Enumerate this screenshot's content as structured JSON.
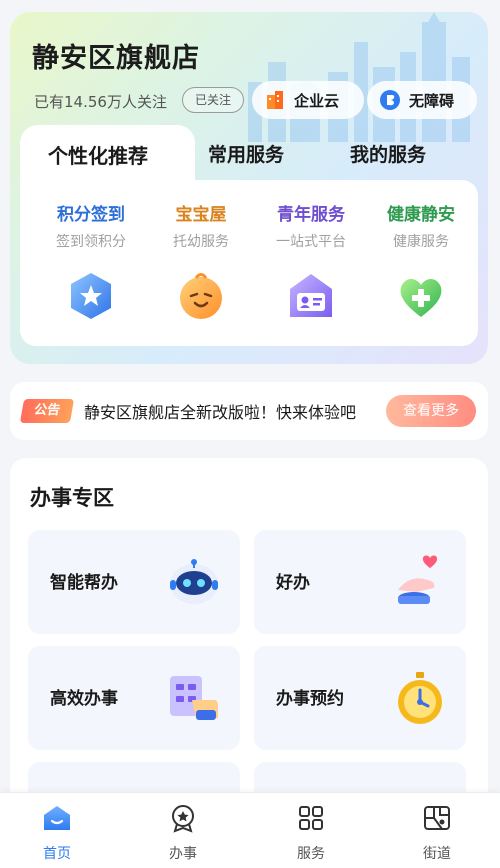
{
  "header": {
    "title": "静安区旗舰店",
    "followers": "已有14.56万人关注",
    "follow_button": "已关注",
    "enterprise_cloud": "企业云",
    "accessibility": "无障碍"
  },
  "tabs": [
    {
      "label": "个性化推荐",
      "active": true
    },
    {
      "label": "常用服务",
      "active": false
    },
    {
      "label": "我的服务",
      "active": false
    }
  ],
  "featured_services": [
    {
      "title": "积分签到",
      "subtitle": "签到领积分",
      "color": "#2f6fd8",
      "icon": "star-shield-icon"
    },
    {
      "title": "宝宝屋",
      "subtitle": "托幼服务",
      "color": "#d9821e",
      "icon": "baby-face-icon"
    },
    {
      "title": "青年服务",
      "subtitle": "一站式平台",
      "color": "#6f4ed0",
      "icon": "id-card-house-icon"
    },
    {
      "title": "健康静安",
      "subtitle": "健康服务",
      "color": "#2e9b4f",
      "icon": "health-heart-icon"
    }
  ],
  "notice": {
    "tag": "公告",
    "text": "静安区旗舰店全新改版啦！快来体验吧",
    "button": "查看更多"
  },
  "zone": {
    "title": "办事专区",
    "cards": [
      {
        "label": "智能帮办",
        "icon": "robot-icon"
      },
      {
        "label": "好办",
        "icon": "hand-heart-icon"
      },
      {
        "label": "高效办事",
        "icon": "document-check-icon"
      },
      {
        "label": "办事预约",
        "icon": "stopwatch-icon"
      }
    ]
  },
  "bottom_nav": [
    {
      "label": "首页",
      "icon": "home-icon",
      "active": true
    },
    {
      "label": "办事",
      "icon": "star-badge-icon",
      "active": false
    },
    {
      "label": "服务",
      "icon": "grid-icon",
      "active": false
    },
    {
      "label": "街道",
      "icon": "map-icon",
      "active": false
    }
  ],
  "colors": {
    "accent": "#2f7bf0",
    "notice_tag": "#ff6d5a",
    "notice_button": "#ff8d82"
  }
}
